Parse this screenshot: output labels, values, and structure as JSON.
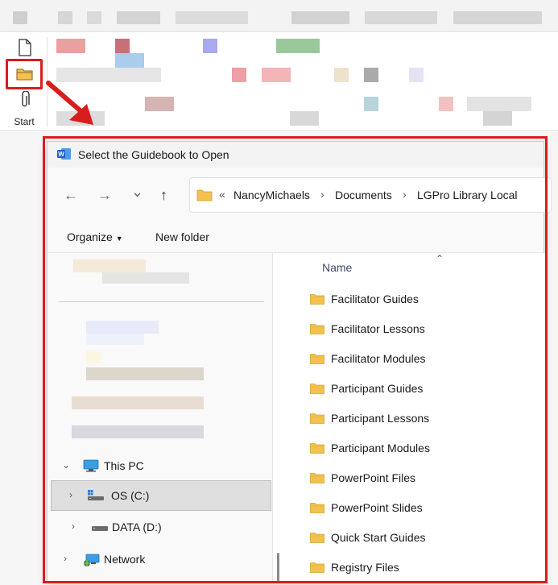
{
  "ribbon": {
    "start_label": "Start",
    "icons": [
      "new-document-icon",
      "open-folder-icon",
      "attach-icon"
    ]
  },
  "dialog": {
    "title": "Select the Guidebook to Open",
    "app_icon": "word-icon",
    "nav": {
      "back": "←",
      "forward": "→",
      "recent": "⌄",
      "up": "↑"
    },
    "address": {
      "overflow": "«",
      "crumbs": [
        "NancyMichaels",
        "Documents",
        "LGPro Library Local"
      ]
    },
    "toolbar": {
      "organize_label": "Organize",
      "new_folder_label": "New folder"
    },
    "tree": {
      "this_pc": "This PC",
      "os_drive": "OS (C:)",
      "data_drive": "DATA (D:)",
      "network": "Network"
    },
    "files": {
      "column_name": "Name",
      "items": [
        "Facilitator Guides",
        "Facilitator Lessons",
        "Facilitator Modules",
        "Participant Guides",
        "Participant Lessons",
        "Participant Modules",
        "PowerPoint Files",
        "PowerPoint Slides",
        "Quick Start Guides",
        "Registry Files"
      ]
    }
  },
  "colors": {
    "highlight": "#d91d1d",
    "folder": "#f2c14e",
    "selected_row": "#dedede"
  }
}
